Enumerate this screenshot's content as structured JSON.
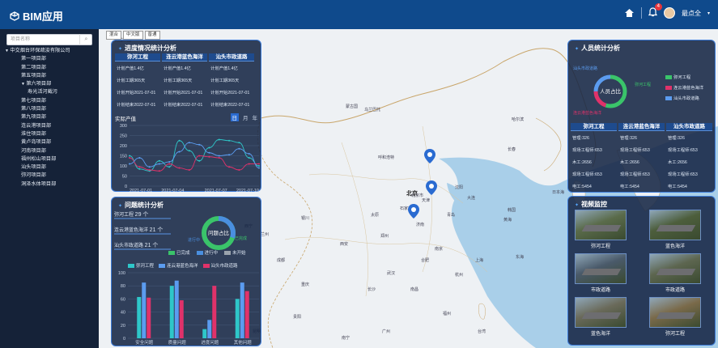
{
  "app": {
    "title": "BIM应用",
    "user": "最点全",
    "notif_count": "4"
  },
  "search": {
    "placeholder": "项目名称"
  },
  "tree": [
    {
      "label": "中交烟台环保疏浚有限公司",
      "level": 1,
      "arrow": "▼"
    },
    {
      "label": "第一项目部",
      "level": 2
    },
    {
      "label": "第二项目部",
      "level": 2
    },
    {
      "label": "第五项目部",
      "level": 2
    },
    {
      "label": "第六项目部",
      "level": 2,
      "arrow": "▼"
    },
    {
      "label": "寿光活河截污",
      "level": 3
    },
    {
      "label": "第七项目部",
      "level": 2
    },
    {
      "label": "第八项目部",
      "level": 2
    },
    {
      "label": "第九项目部",
      "level": 2
    },
    {
      "label": "连云港项目部",
      "level": 2
    },
    {
      "label": "淮住项目部",
      "level": 2
    },
    {
      "label": "黄卢岛项目部",
      "level": 2
    },
    {
      "label": "河南项目部",
      "level": 2
    },
    {
      "label": "福州松山项目部",
      "level": 2
    },
    {
      "label": "汕头项目部",
      "level": 2
    },
    {
      "label": "弥河项目部",
      "level": 2
    },
    {
      "label": "洞泽水体项目部",
      "level": 2
    }
  ],
  "map_tabs": [
    "混合",
    "中文版",
    "普通"
  ],
  "progress": {
    "title": "进度情况统计分析",
    "columns": [
      "弥河工程",
      "连云港蓝色海洋",
      "汕头市政道路"
    ],
    "rows": [
      [
        "计划产值1.4亿",
        "计划产值1.4亿",
        "计划产值1.4亿"
      ],
      [
        "计划工期365天",
        "计划工期365天",
        "计划工期365天"
      ],
      [
        "计划开始2021-07-01",
        "计划开始2021-07-01",
        "计划开始2021-07-01"
      ],
      [
        "计划结束2022-07-01",
        "计划结束2022-07-01",
        "计划结束2022-07-01"
      ]
    ],
    "chart_label": "实际产值",
    "periods": [
      "日",
      "月",
      "年"
    ]
  },
  "problems": {
    "title": "问题统计分析",
    "items": [
      {
        "label": "弥河工程",
        "count": "29 个"
      },
      {
        "label": "连云港蓝色海洋",
        "count": "21 个"
      },
      {
        "label": "汕头市政道路",
        "count": "21 个"
      }
    ],
    "donut_center": "问题占比",
    "donut_labels": [
      "进行中",
      "已完成"
    ],
    "status_legend": [
      "已完成",
      "进行中",
      "未开始"
    ],
    "status_colors": [
      "#3ac46a",
      "#4a8fe0",
      "#9aa3ad"
    ],
    "project_legend": [
      "弥河工程",
      "连云港蓝色海洋",
      "汕头市政道路"
    ]
  },
  "staff": {
    "title": "人员统计分析",
    "donut_center": "人员占比",
    "donut_labels": [
      "汕头市政道路",
      "弥河工程",
      "连云港蓝色海洋"
    ],
    "legend": [
      "弥河工程",
      "连云港蓝色海洋",
      "汕头市政道路"
    ],
    "columns": [
      "弥河工程",
      "连云港蓝色海洋",
      "汕头市政道路"
    ],
    "rows": [
      [
        "管理:326",
        "管理:326",
        "管理:326"
      ],
      [
        "现场工程师:653",
        "现场工程师:653",
        "现场工程师:653"
      ],
      [
        "木工:2656",
        "木工:2656",
        "木工:2656"
      ],
      [
        "现场工程师:653",
        "现场工程师:653",
        "现场工程师:653"
      ],
      [
        "电工:5454",
        "电工:5454",
        "电工:5454"
      ]
    ]
  },
  "video": {
    "title": "视频监控",
    "items": [
      "弥河工程",
      "蓝色海洋",
      "市政道路",
      "市政道路",
      "蓝色海洋",
      "弥河工程"
    ]
  },
  "map_labels": [
    "北京",
    "天津",
    "沈阳",
    "呼和浩特",
    "石家庄",
    "济南",
    "郑州",
    "西安",
    "南京",
    "合肥",
    "武汉",
    "长沙",
    "南昌",
    "福州",
    "杭州",
    "上海",
    "成都",
    "重庆",
    "贵阳",
    "昆明",
    "南宁",
    "广州",
    "台湾",
    "银川",
    "兰州",
    "西宁",
    "太原",
    "青岛",
    "大连",
    "北京市",
    "韩国",
    "东海",
    "黄海",
    "日本海",
    "东京",
    "蒙古国",
    "乌兰巴托",
    "哈尔滨",
    "长春",
    "阿拉木图"
  ],
  "colors": {
    "series1": "#2ec7c9",
    "series2": "#e0326a",
    "series3": "#5b9cf0",
    "accent": "#3c7bd8",
    "header": "#0f4a8c"
  },
  "chart_data": [
    {
      "type": "line",
      "title": "实际产值",
      "x": [
        "2021-07-01",
        "2021-07-04",
        "2021-07-07",
        "2021-07-10"
      ],
      "ylim": [
        0,
        300
      ],
      "yticks": [
        0,
        50,
        100,
        150,
        200,
        250,
        300
      ],
      "series": [
        {
          "name": "弥河工程",
          "values": [
            150,
            85,
            75,
            125,
            95,
            225,
            175,
            125,
            190,
            230,
            225,
            215,
            140,
            100
          ]
        },
        {
          "name": "连云港蓝色海洋",
          "values": [
            140,
            95,
            80,
            75,
            110,
            90,
            80,
            150,
            145,
            140,
            95,
            80,
            110,
            110
          ]
        },
        {
          "name": "汕头市政道路",
          "values": [
            110,
            140,
            95,
            110,
            120,
            170,
            215,
            205,
            165,
            150,
            155,
            185,
            160,
            90
          ]
        }
      ]
    },
    {
      "type": "bar",
      "categories": [
        "安全问题",
        "质量问题",
        "进度问题",
        "其他问题"
      ],
      "ylim": [
        0,
        100
      ],
      "yticks": [
        0,
        20,
        40,
        60,
        80,
        100
      ],
      "series": [
        {
          "name": "弥河工程",
          "values": [
            63,
            80,
            14,
            60
          ]
        },
        {
          "name": "连云港蓝色海洋",
          "values": [
            85,
            88,
            28,
            85
          ]
        },
        {
          "name": "汕头市政道路",
          "values": [
            62,
            58,
            80,
            72
          ]
        }
      ]
    }
  ]
}
